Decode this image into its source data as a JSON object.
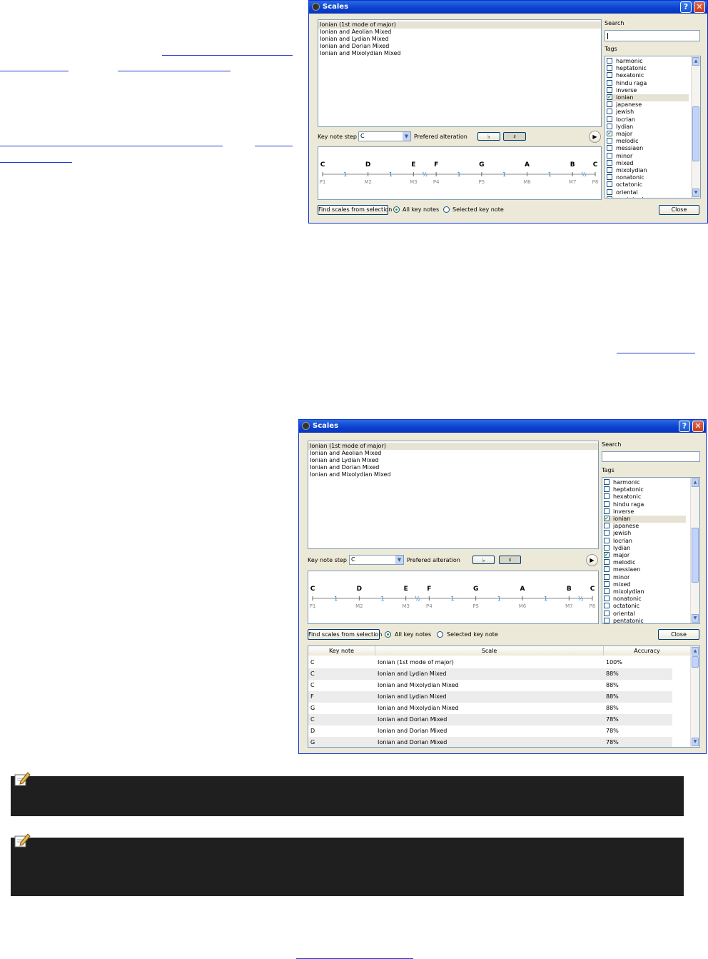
{
  "window_title": "Scales",
  "help_glyph": "?",
  "close_glyph": "✕",
  "scale_list": [
    "Ionian (1st mode of major)",
    "Ionian and Aeolian Mixed",
    "Ionian and Lydian Mixed",
    "Ionian and Dorian Mixed",
    "Ionian and Mixolydian Mixed"
  ],
  "search_label": "Search",
  "tags_label": "Tags",
  "tags": [
    {
      "name": "harmonic",
      "checked": false
    },
    {
      "name": "heptatonic",
      "checked": false
    },
    {
      "name": "hexatonic",
      "checked": false
    },
    {
      "name": "hindu raga",
      "checked": false
    },
    {
      "name": "inverse",
      "checked": false
    },
    {
      "name": "ionian",
      "checked": true
    },
    {
      "name": "japanese",
      "checked": false
    },
    {
      "name": "jewish",
      "checked": false
    },
    {
      "name": "locrian",
      "checked": false
    },
    {
      "name": "lydian",
      "checked": false
    },
    {
      "name": "major",
      "checked": true
    },
    {
      "name": "melodic",
      "checked": false
    },
    {
      "name": "messiaen",
      "checked": false
    },
    {
      "name": "minor",
      "checked": false
    },
    {
      "name": "mixed",
      "checked": false
    },
    {
      "name": "mixolydian",
      "checked": false
    },
    {
      "name": "nonatonic",
      "checked": false
    },
    {
      "name": "octatonic",
      "checked": false
    },
    {
      "name": "oriental",
      "checked": false
    },
    {
      "name": "pentatonic",
      "checked": false
    }
  ],
  "key_note_label": "Key note step",
  "key_note_value": "C",
  "alteration_label": "Prefered alteration",
  "flat_glyph": "♭",
  "sharp_glyph": "♯",
  "play_glyph": "▶",
  "notes": [
    "C",
    "D",
    "E",
    "F",
    "G",
    "A",
    "B",
    "C"
  ],
  "steps": [
    "1",
    "1",
    "½",
    "1",
    "1",
    "1",
    "½"
  ],
  "intervals": [
    "P1",
    "M2",
    "M3",
    "P4",
    "P5",
    "M6",
    "M7",
    "P8"
  ],
  "find_button": "Find scales from selection",
  "radio_all": "All key notes",
  "radio_selected": "Selected key note",
  "close_button": "Close",
  "results": {
    "headers": [
      "Key note",
      "Scale",
      "Accuracy"
    ],
    "rows": [
      [
        "C",
        "Ionian (1st mode of major)",
        "100%"
      ],
      [
        "C",
        "Ionian and Lydian Mixed",
        "88%"
      ],
      [
        "C",
        "Ionian and Mixolydian Mixed",
        "88%"
      ],
      [
        "F",
        "Ionian and Lydian Mixed",
        "88%"
      ],
      [
        "G",
        "Ionian and Mixolydian Mixed",
        "88%"
      ],
      [
        "C",
        "Ionian and Dorian Mixed",
        "78%"
      ],
      [
        "D",
        "Ionian and Dorian Mixed",
        "78%"
      ],
      [
        "G",
        "Ionian and Dorian Mixed",
        "78%"
      ]
    ]
  },
  "colors": {
    "step_blue": "#1a7fc4",
    "title_blue": "#0a3fd0",
    "note_bar": "#1f1f1f"
  }
}
